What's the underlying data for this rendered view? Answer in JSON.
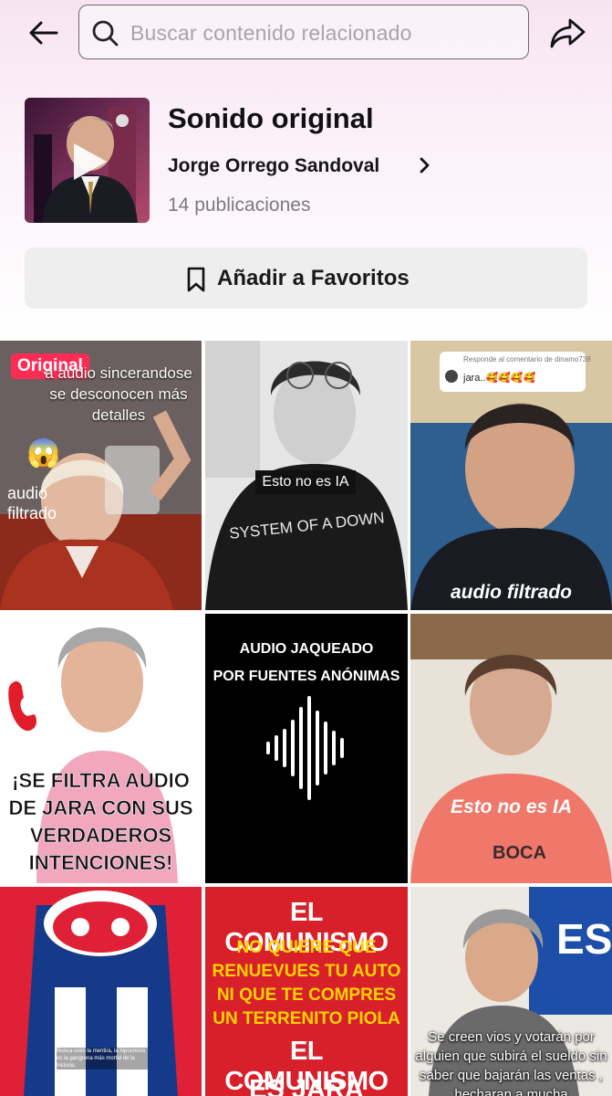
{
  "search": {
    "placeholder": "Buscar contenido relacionado"
  },
  "sound": {
    "title": "Sonido original",
    "author": "Jorge Orrego Sandoval",
    "count": "14 publicaciones"
  },
  "favorites_label": "Añadir a Favoritos",
  "colors": {
    "brand": "#fe2c55",
    "placeholder": "#a9a4a8",
    "button_bg": "#eeeeee"
  },
  "videos": [
    {
      "badge": "Original",
      "caption_top": "a audio sincerandose se desconocen más detalles",
      "caption_bottom": "audio filtrado",
      "emoji": "😱"
    },
    {
      "caption": "Esto no es IA",
      "shirt_text": "SYSTEM OF A DOWN"
    },
    {
      "comment_header": "Responde al comentario de dinamo738",
      "comment_text": "jara..🥰🥰🥰🥰",
      "caption": "audio filtrado"
    },
    {
      "caption": "¡SE FILTRA AUDIO DE JARA CON SUS VERDADEROS INTENCIONES!"
    },
    {
      "caption_line1": "AUDIO JAQUEADO",
      "caption_line2": "POR FUENTES ANÓNIMAS"
    },
    {
      "caption": "Esto no es IA"
    },
    {
      "caption": "Nunca uses la mentira, la hipocresía es la gangrena más mortal de la historia."
    },
    {
      "line1": "EL COMUNISMO",
      "line2": "NO QUIERE QUE",
      "line3": "RENUEVUES TU AUTO",
      "line4": "NI QUE TE COMPRES",
      "line5": "UN TERRENITO PIOLA",
      "line6": "EL COMUNISMO",
      "line7": "ES JARA"
    },
    {
      "caption": "Se creen vios y votarán por alguien que subirá el sueldo sin saber que bajarán las ventas , hecharan a mucha",
      "sign": "ES"
    }
  ]
}
